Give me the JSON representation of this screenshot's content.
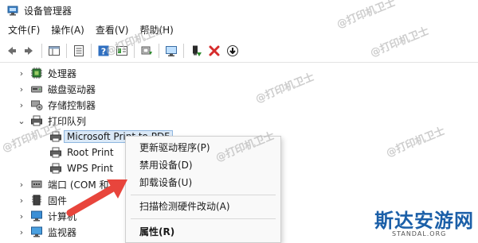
{
  "window": {
    "title": "设备管理器"
  },
  "menubar": [
    {
      "label": "文件(F)"
    },
    {
      "label": "操作(A)"
    },
    {
      "label": "查看(V)"
    },
    {
      "label": "帮助(H)"
    }
  ],
  "toolbar": {
    "buttons": [
      "back-arrow-icon",
      "forward-arrow-icon",
      "properties-grid-icon",
      "device-list-icon",
      "help-icon",
      "properties-panel-icon",
      "update-driver-icon",
      "scan-monitor-icon",
      "enable-device-icon",
      "uninstall-device-icon",
      "download-driver-icon"
    ]
  },
  "tree": {
    "items": [
      {
        "label": "处理器",
        "icon": "processor-icon",
        "expanded": false
      },
      {
        "label": "磁盘驱动器",
        "icon": "disk-drive-icon",
        "expanded": false
      },
      {
        "label": "存储控制器",
        "icon": "storage-controller-icon",
        "expanded": false
      },
      {
        "label": "打印队列",
        "icon": "printer-icon",
        "expanded": true
      },
      {
        "label": "Microsoft Print to PDF",
        "icon": "printer-icon",
        "child": true,
        "selected": true
      },
      {
        "label": "Root Print",
        "icon": "printer-icon",
        "child": true
      },
      {
        "label": "WPS Print",
        "icon": "printer-icon",
        "child": true
      },
      {
        "label": "端口 (COM 和",
        "icon": "port-icon",
        "expanded": false
      },
      {
        "label": "固件",
        "icon": "firmware-icon",
        "expanded": false
      },
      {
        "label": "计算机",
        "icon": "computer-icon",
        "expanded": false
      },
      {
        "label": "监视器",
        "icon": "monitor-icon",
        "expanded": false
      }
    ]
  },
  "context_menu": {
    "items": [
      {
        "label": "更新驱动程序(P)"
      },
      {
        "label": "禁用设备(D)"
      },
      {
        "label": "卸载设备(U)"
      },
      {
        "label": "扫描检测硬件改动(A)"
      },
      {
        "label": "属性(R)",
        "bold": true
      }
    ]
  },
  "watermarks": [
    "@打印机卫士",
    "@打印机卫士",
    "@打印机卫士",
    "@打印机卫士",
    "@打印机卫士",
    "@打印机卫士",
    "@打印机卫士"
  ],
  "logo": {
    "title": "斯达安游网",
    "subtitle": "STANDAL.ORG"
  },
  "colors": {
    "accent": "#1b5fa8",
    "arrow": "#e8453c",
    "selection": "#dbe9f7",
    "delete_red": "#d62c2c",
    "enable_green": "#2e8b2e"
  }
}
